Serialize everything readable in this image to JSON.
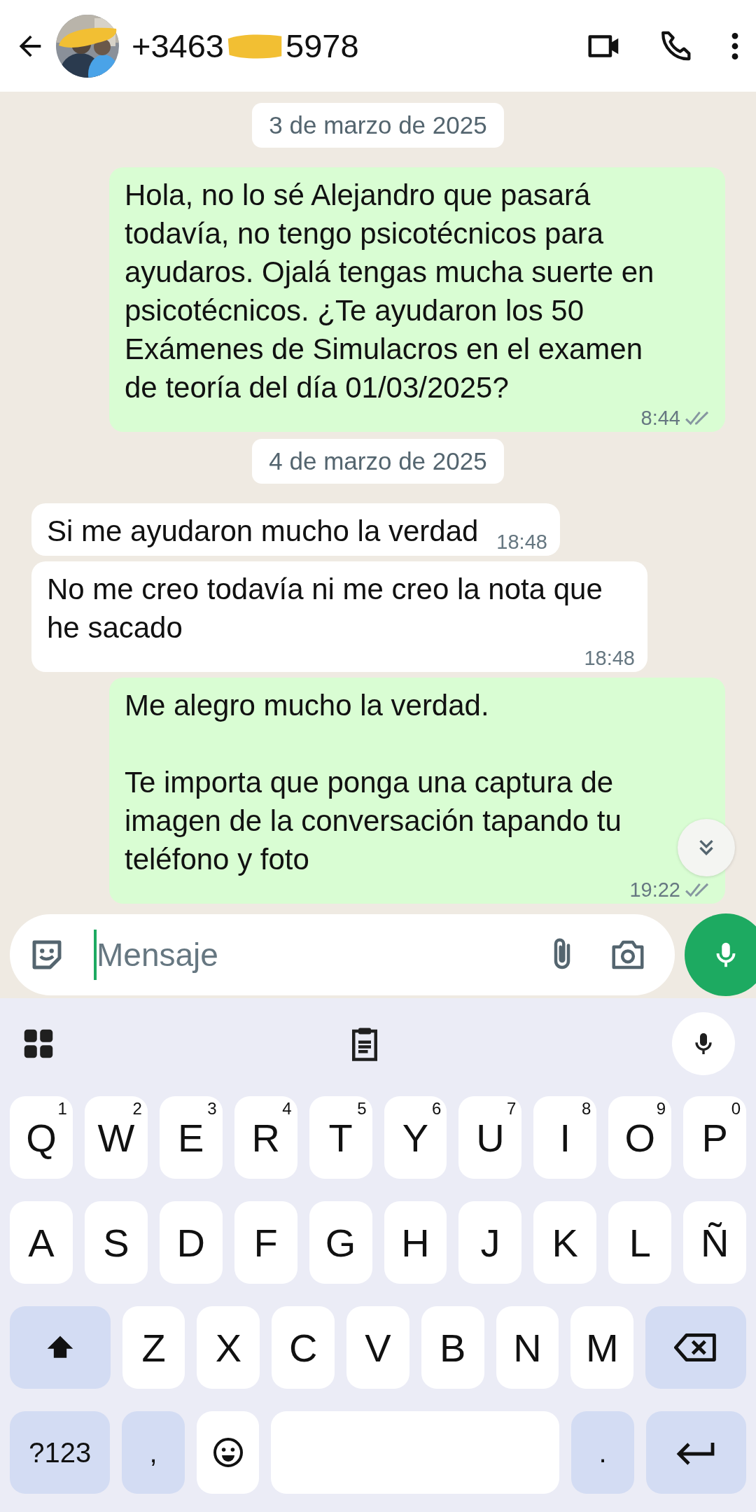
{
  "header": {
    "number_start": "+3463",
    "number_end": "5978"
  },
  "chat": [
    {
      "kind": "date",
      "text": "3 de marzo de 2025"
    },
    {
      "kind": "message",
      "outgoing": true,
      "text": "Hola, no lo sé Alejandro que pasará todavía, no tengo psicotécnicos para ayudaros. Ojalá tengas mucha suerte en psicotécnicos. ¿Te ayudaron los 50 Exámenes de Simulacros en el examen de teoría del día 01/03/2025?",
      "time": "8:44",
      "delivered": true
    },
    {
      "kind": "date",
      "text": "4 de marzo de 2025"
    },
    {
      "kind": "message",
      "outgoing": false,
      "text": "Si me ayudaron mucho la verdad",
      "time": "18:48"
    },
    {
      "kind": "message",
      "outgoing": false,
      "text": "No me creo todavía ni me creo la nota que he sacado",
      "time": "18:48"
    },
    {
      "kind": "message",
      "outgoing": true,
      "text": "Me alegro mucho la verdad.\n\nTe importa que ponga una captura de imagen de la conversación tapando tu teléfono y foto",
      "time": "19:22",
      "delivered": true
    }
  ],
  "composer": {
    "placeholder": "Mensaje"
  },
  "keyboard": {
    "rows": [
      [
        {
          "kind": "letter",
          "label": "Q",
          "sup": "1"
        },
        {
          "kind": "letter",
          "label": "W",
          "sup": "2"
        },
        {
          "kind": "letter",
          "label": "E",
          "sup": "3"
        },
        {
          "kind": "letter",
          "label": "R",
          "sup": "4"
        },
        {
          "kind": "letter",
          "label": "T",
          "sup": "5"
        },
        {
          "kind": "letter",
          "label": "Y",
          "sup": "6"
        },
        {
          "kind": "letter",
          "label": "U",
          "sup": "7"
        },
        {
          "kind": "letter",
          "label": "I",
          "sup": "8"
        },
        {
          "kind": "letter",
          "label": "O",
          "sup": "9"
        },
        {
          "kind": "letter",
          "label": "P",
          "sup": "0"
        }
      ],
      [
        {
          "kind": "letter",
          "label": "A"
        },
        {
          "kind": "letter",
          "label": "S"
        },
        {
          "kind": "letter",
          "label": "D"
        },
        {
          "kind": "letter",
          "label": "F"
        },
        {
          "kind": "letter",
          "label": "G"
        },
        {
          "kind": "letter",
          "label": "H"
        },
        {
          "kind": "letter",
          "label": "J"
        },
        {
          "kind": "letter",
          "label": "K"
        },
        {
          "kind": "letter",
          "label": "L"
        },
        {
          "kind": "letter",
          "label": "Ñ"
        }
      ],
      [
        {
          "kind": "shift"
        },
        {
          "kind": "letter",
          "label": "Z"
        },
        {
          "kind": "letter",
          "label": "X"
        },
        {
          "kind": "letter",
          "label": "C"
        },
        {
          "kind": "letter",
          "label": "V"
        },
        {
          "kind": "letter",
          "label": "B"
        },
        {
          "kind": "letter",
          "label": "N"
        },
        {
          "kind": "letter",
          "label": "M"
        },
        {
          "kind": "backspace"
        }
      ],
      [
        {
          "kind": "symbols",
          "label": "?123"
        },
        {
          "kind": "punct",
          "label": ","
        },
        {
          "kind": "emoji"
        },
        {
          "kind": "space"
        },
        {
          "kind": "punct",
          "label": "."
        },
        {
          "kind": "enter"
        }
      ]
    ]
  }
}
